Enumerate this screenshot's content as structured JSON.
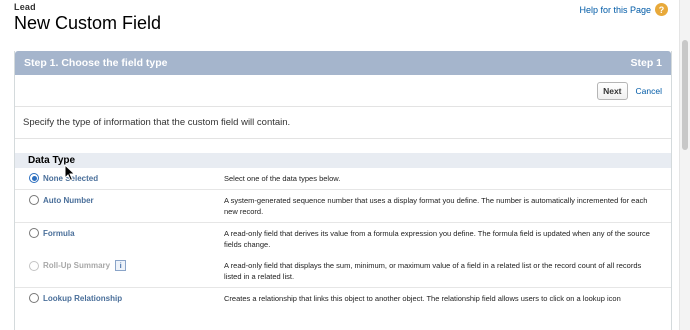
{
  "header": {
    "breadcrumb": "Lead",
    "title": "New Custom Field",
    "help_label": "Help for this Page",
    "help_icon": "question-circle-icon"
  },
  "step": {
    "title": "Step 1. Choose the field type",
    "number_label": "Step 1"
  },
  "buttons": {
    "next_label": "Next",
    "cancel_label": "Cancel"
  },
  "description": "Specify the type of information that the custom field will contain.",
  "data_type_section": {
    "heading": "Data Type",
    "types": [
      {
        "label": "None Selected",
        "desc": "Select one of the data types below.",
        "selected": true,
        "disabled": false
      },
      {
        "label": "Auto Number",
        "desc": "A system-generated sequence number that uses a display format you define. The number is automatically incremented for each new record.",
        "selected": false,
        "disabled": false
      },
      {
        "label": "Formula",
        "desc": "A read-only field that derives its value from a formula expression you define. The formula field is updated when any of the source fields change.",
        "selected": false,
        "disabled": false
      },
      {
        "label": "Roll-Up Summary",
        "desc": "A read-only field that displays the sum, minimum, or maximum value of a field in a related list or the record count of all records listed in a related list.",
        "selected": false,
        "disabled": true,
        "info_icon": "i"
      },
      {
        "label": "Lookup Relationship",
        "desc": "Creates a relationship that links this object to another object. The relationship field allows users to click on a lookup icon",
        "selected": false,
        "disabled": false
      }
    ]
  },
  "colors": {
    "step_bar": "#a5b5cc",
    "link": "#015ba7",
    "help_icon": "#e8a93a"
  }
}
